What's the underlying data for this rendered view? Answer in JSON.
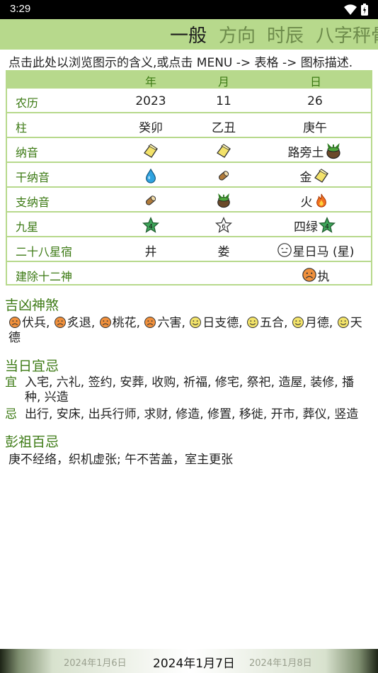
{
  "status": {
    "time": "3:29"
  },
  "tabs": [
    {
      "label": "一般"
    },
    {
      "label": "方向"
    },
    {
      "label": "时辰"
    },
    {
      "label": "八字秤骨"
    }
  ],
  "hint": "点击此处以浏览图示的含义,或点击 MENU -> 表格 -> 图标描述.",
  "table": {
    "headers": [
      "年",
      "月",
      "日"
    ],
    "rows": [
      {
        "label": "农历",
        "year": "2023",
        "month": "11",
        "day": "26"
      },
      {
        "label": "柱",
        "year": "癸卯",
        "month": "乙丑",
        "day": "庚午"
      },
      {
        "label": "纳音",
        "year_icon": "gold-ingot-icon",
        "month_icon": "gold-ingot-icon",
        "day": "路旁土",
        "day_icon": "soil-pot-icon"
      },
      {
        "label": "干纳音",
        "year_icon": "water-drop-icon",
        "month_icon": "wood-log-icon",
        "day": "金",
        "day_icon": "gold-ingot-icon"
      },
      {
        "label": "支纳音",
        "year_icon": "wood-log-icon",
        "month_icon": "soil-pot-icon",
        "day": "火",
        "day_icon": "fire-icon"
      },
      {
        "label": "九星",
        "year_star": "4",
        "month_star": "6",
        "day": "四绿",
        "day_star": "4"
      },
      {
        "label": "二十八星宿",
        "year": "井",
        "month": "娄",
        "day": "星日马 (星)",
        "day_icon": "neutral-face-icon"
      },
      {
        "label": "建除十二神",
        "day": "执",
        "day_icon": "sad-face-icon"
      }
    ]
  },
  "jixiong": {
    "title": "吉凶神煞",
    "items": [
      {
        "name": "伏兵",
        "mood": "bad"
      },
      {
        "name": "炙退",
        "mood": "bad"
      },
      {
        "name": "桃花",
        "mood": "bad"
      },
      {
        "name": "六害",
        "mood": "bad"
      },
      {
        "name": "日支德",
        "mood": "good"
      },
      {
        "name": "五合",
        "mood": "good"
      },
      {
        "name": "月德",
        "mood": "good"
      },
      {
        "name": "天德",
        "mood": "good"
      }
    ]
  },
  "yiji": {
    "title": "当日宜忌",
    "yi_label": "宜",
    "yi_line1": "入宅, 六礼, 签约, 安葬, 收购, 祈福, 修宅, 祭祀, 造屋, 装修, 播",
    "yi_line2": "种, 兴造",
    "ji_label": "忌",
    "ji_text": "出行, 安床, 出兵行师, 求财, 修造, 修置, 移徙, 开市, 葬仪, 竖造"
  },
  "pengzu": {
    "title": "彭祖百忌",
    "text": "庚不经络，织机虚张; 午不苦盖，室主更张"
  },
  "dates": {
    "prev": "2024年1月6日",
    "current": "2024年1月7日",
    "next": "2024年1月8日"
  },
  "colors": {
    "accent": "#b7d98c",
    "label_green": "#3c7a14",
    "bad_face": "#f0903c",
    "good_face": "#f2e36a",
    "star_green": "#3ea55a"
  }
}
